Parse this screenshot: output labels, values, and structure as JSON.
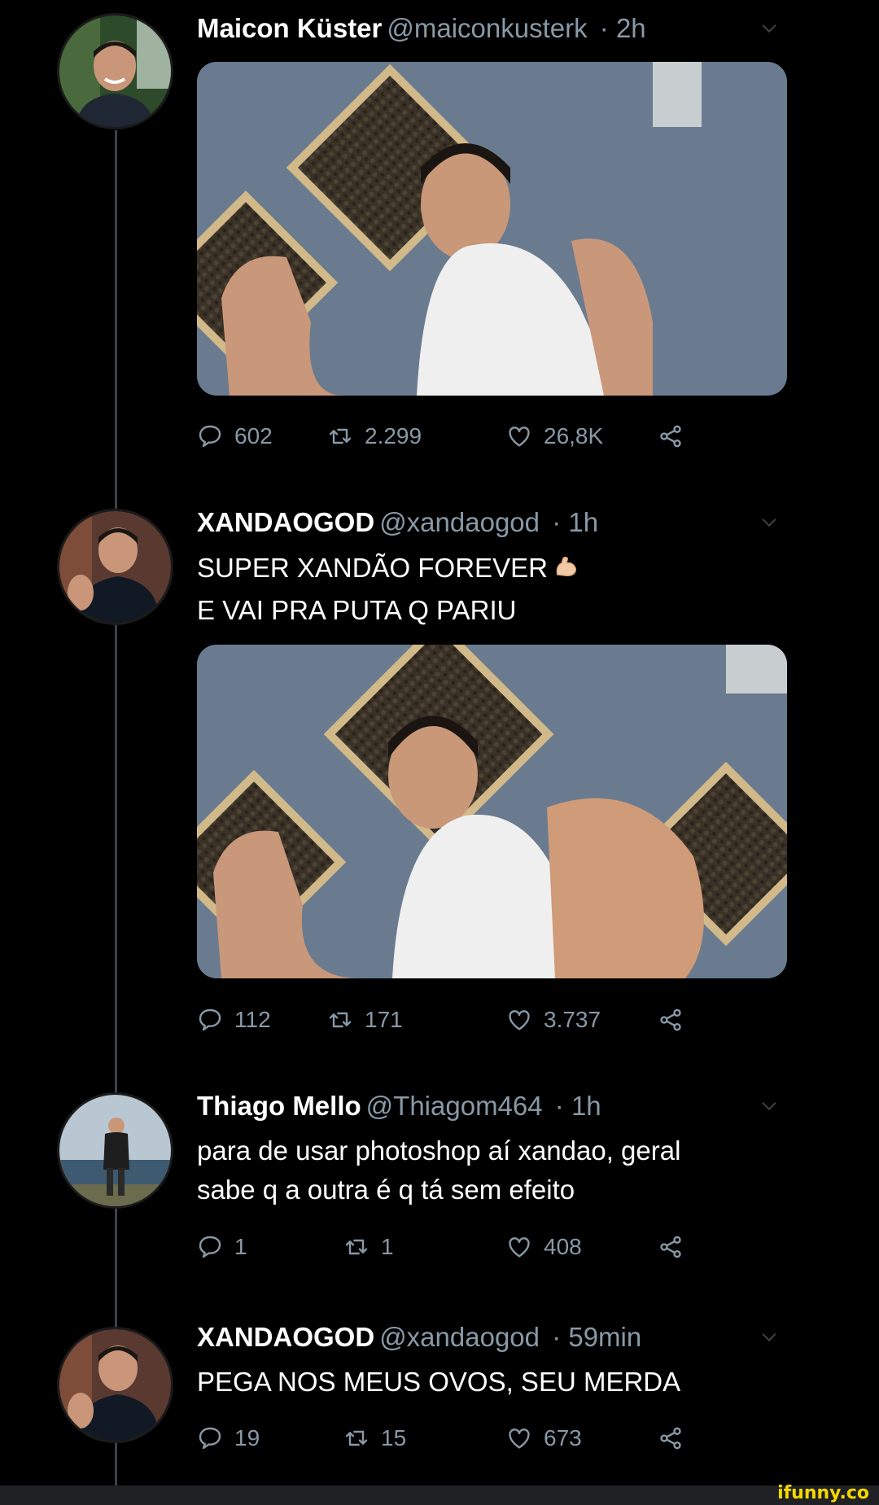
{
  "colors": {
    "background": "#000000",
    "muted": "#8899a6",
    "thread_line": "#3d4247"
  },
  "tweets": [
    {
      "name": "Maicon Küster",
      "handle": "@maiconkusterk",
      "time": "· 2h",
      "lines": [],
      "media": "photo-man-flexing-normal",
      "replies": "602",
      "retweets": "2.299",
      "likes": "26,8K"
    },
    {
      "name": "XANDAOGOD",
      "handle": "@xandaogod",
      "time": "· 1h",
      "lines": [
        "SUPER XANDÃO FOREVER",
        "E VAI PRA PUTA Q PARIU"
      ],
      "emoji": "flexed-biceps-icon",
      "media": "photo-man-flexing-huge-arms",
      "replies": "112",
      "retweets": "171",
      "likes": "3.737"
    },
    {
      "name": "Thiago Mello",
      "handle": "@Thiagom464",
      "time": "· 1h",
      "lines": [
        "para de usar photoshop aí xandao, geral",
        "sabe q a outra é q tá sem efeito"
      ],
      "replies": "1",
      "retweets": "1",
      "likes": "408"
    },
    {
      "name": "XANDAOGOD",
      "handle": "@xandaogod",
      "time": "· 59min",
      "lines": [
        "PEGA NOS MEUS OVOS, SEU MERDA"
      ],
      "replies": "19",
      "retweets": "15",
      "likes": "673"
    }
  ],
  "watermark": "ifunny.co"
}
